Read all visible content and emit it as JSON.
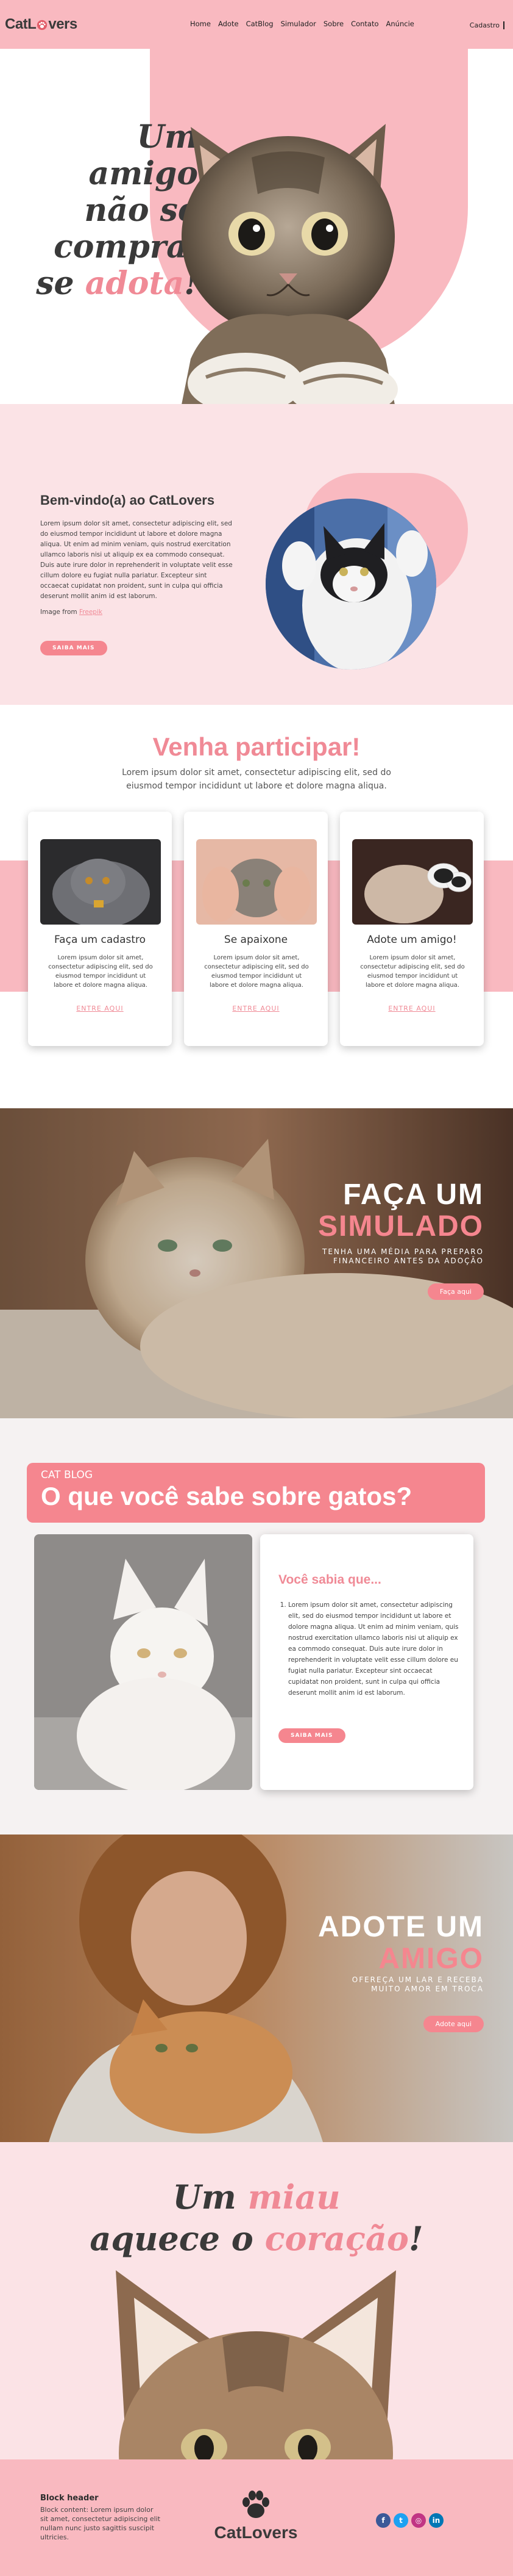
{
  "nav": {
    "logo": "CatLovers",
    "items": [
      "Home",
      "Adote",
      "CatBlog",
      "Simulador",
      "Sobre",
      "Contato",
      "Anúncie"
    ],
    "signup": "Cadastro"
  },
  "hero": {
    "line1": "Um amigo",
    "line2": "não se",
    "line3": "compra,",
    "line4_prefix": "se ",
    "line4_pink": "adota",
    "line4_suffix": "!"
  },
  "welcome": {
    "title_prefix": "Bem-vindo(a) ao ",
    "title_brand": "CatLovers",
    "body": "Lorem ipsum dolor sit amet, consectetur adipiscing elit, sed do eiusmod tempor incididunt ut labore et dolore magna aliqua. Ut enim ad minim veniam, quis nostrud exercitation ullamco laboris nisi ut aliquip ex ea commodo consequat. Duis aute irure dolor in reprehenderit in voluptate velit esse cillum dolore eu fugiat nulla pariatur. Excepteur sint occaecat cupidatat non proident, sunt in culpa qui officia deserunt mollit anim id est laborum.",
    "credit_prefix": "Image from ",
    "credit_link": "Freepik",
    "button": "Saiba mais"
  },
  "participate": {
    "title": "Venha participar!",
    "subtitle": "Lorem ipsum dolor sit amet, consectetur adipiscing elit, sed do eiusmod tempor incididunt ut labore et dolore magna aliqua.",
    "cards": [
      {
        "title": "Faça um cadastro",
        "text": "Lorem ipsum dolor sit amet, consectetur adipiscing elit, sed do eiusmod tempor incididunt ut labore et dolore magna aliqua.",
        "link": "ENTRE AQUI"
      },
      {
        "title": "Se apaixone",
        "text": "Lorem ipsum dolor sit amet, consectetur adipiscing elit, sed do eiusmod tempor incididunt ut labore et dolore magna aliqua.",
        "link": "ENTRE AQUI"
      },
      {
        "title": "Adote um amigo!",
        "text": "Lorem ipsum dolor sit amet, consectetur adipiscing elit, sed do eiusmod tempor incididunt ut labore et dolore magna aliqua.",
        "link": "ENTRE AQUI"
      }
    ]
  },
  "simulate": {
    "title_white": "FAÇA UM",
    "title_pink": "SIMULADO",
    "sub1": "Tenha uma média para preparo",
    "sub2": "financeiro antes da adoção",
    "button": "Faça aqui"
  },
  "blog": {
    "tag": "CAT BLOG",
    "title": "O que você sabe sobre gatos?",
    "card_title": "Você sabia que...",
    "item": "Lorem ipsum dolor sit amet, consectetur adipiscing elit, sed do eiusmod tempor incididunt ut labore et dolore magna aliqua. Ut enim ad minim veniam, quis nostrud exercitation ullamco laboris nisi ut aliquip ex ea commodo consequat. Duis aute irure dolor in reprehenderit in voluptate velit esse cillum dolore eu fugiat nulla pariatur. Excepteur sint occaecat cupidatat non proident, sunt in culpa qui officia deserunt mollit anim id est laborum.",
    "button": "Saiba mais"
  },
  "adopt": {
    "title_white": "ADOTE UM",
    "title_pink": "AMIGO",
    "sub1": "Ofereça um lar e receba",
    "sub2": "muito amor em troca",
    "button": "Adote aqui"
  },
  "meow": {
    "l1a": "Um ",
    "l1b": "miau",
    "l2a": "aquece o ",
    "l2b": "coração",
    "l2c": "!"
  },
  "footer": {
    "block_header": "Block header",
    "block_content": "Block content: Lorem ipsum dolor sit amet, consectetur adipiscing elit nullam nunc justo sagittis suscipit ultricies.",
    "logo": "CatLovers",
    "social": [
      {
        "icon": "facebook-icon",
        "glyph": "f",
        "color": "#3b5998"
      },
      {
        "icon": "twitter-icon",
        "glyph": "t",
        "color": "#1da1f2"
      },
      {
        "icon": "instagram-icon",
        "glyph": "◎",
        "color": "#c13584"
      },
      {
        "icon": "linkedin-icon",
        "glyph": "in",
        "color": "#0077b5"
      }
    ]
  }
}
